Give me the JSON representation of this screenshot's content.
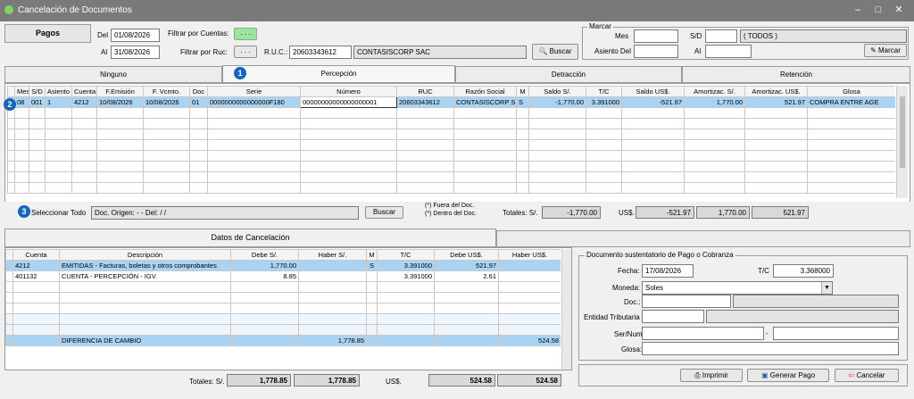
{
  "window": {
    "title": "Cancelación de Documentos"
  },
  "header": {
    "pagos_label": "Pagos",
    "del_label": "Del",
    "del_value": "01/08/2026",
    "al_label": "Al",
    "al_value": "31/08/2026",
    "filtrar_cuentas_label": "Filtrar por Cuentas:",
    "filtrar_cuentas_value": ". . .",
    "filtrar_ruc_label": "Filtrar por Ruc:",
    "filtrar_ruc_value": ". . .",
    "ruc_label": "R.U.C.:",
    "ruc_value": "20603343612",
    "razon_value": "CONTASISCORP SAC",
    "buscar_label": "Buscar"
  },
  "marcar": {
    "title": "Marcar",
    "mes_label": "Mes",
    "sd_label": "S/D",
    "todos_value": "( TODOS )",
    "asiento_label": "Asiento Del",
    "al_label": "Al",
    "button_label": "Marcar"
  },
  "tabs": [
    "Ninguno",
    "Percepción",
    "Detracción",
    "Retención"
  ],
  "badges": [
    "1",
    "2",
    "3"
  ],
  "doc_grid": {
    "columns": [
      "Mes",
      "S/D",
      "Asiento",
      "Cuenta",
      "F.Emisión",
      "F. Vcmto.",
      "Doc",
      "Serie",
      "Número",
      "RUC",
      "Razón Social",
      "M",
      "Saldo S/.",
      "T/C",
      "Saldo US$.",
      "Amortizac. S/.",
      "Amortizac. US$.",
      "Glosa"
    ],
    "rows": [
      [
        "08",
        "001",
        "1",
        "4212",
        "10/08/2026",
        "10/08/2026",
        "01",
        "0000000000000000F180",
        "00000000000000000001",
        "20603343612",
        "CONTASISCORP S",
        "S",
        "-1,770.00",
        "3.391000",
        "-521.97",
        "1,770.00",
        "521.97",
        "COMPRA ENTRE AGE"
      ]
    ]
  },
  "doc_footer": {
    "seleccionar_todo": "Seleccionar Todo",
    "origen": "Doc. Origen:  - -   Del:   / /",
    "buscar": "Buscar",
    "nota1": "(*) Fuera del Doc.",
    "nota2": "(*) Dentro del Doc.",
    "totales_label": "Totales: S/.",
    "tot_soles": "-1,770.00",
    "us_label": "US$.",
    "tot_us": "-521.97",
    "tot_amort_s": "1,770.00",
    "tot_amort_us": "521.97"
  },
  "cancel_tabs": [
    "Datos de Cancelación",
    ""
  ],
  "cancel_grid": {
    "columns": [
      "Cuenta",
      "Descripción",
      "Debe S/.",
      "Haber S/.",
      "M",
      "T/C",
      "Debe US$.",
      "Haber US$."
    ],
    "rows": [
      [
        "4212",
        "EMITIDAS - Facturas, boletas y otros comprobantes",
        "1,770.00",
        "",
        "S",
        "3.391000",
        "521.97",
        ""
      ],
      [
        "401132",
        "CUENTA - PERCEPCIÓN - IGV.",
        "8.85",
        "",
        "",
        "3.391000",
        "2.61",
        ""
      ]
    ],
    "diff_row": [
      "",
      "DIFERENCIA DE CAMBIO",
      "",
      "1,778.85",
      "",
      "",
      "",
      "524.58"
    ]
  },
  "cancel_totals": {
    "label": "Totales: S/.",
    "debe_s": "1,778.85",
    "haber_s": "1,778.85",
    "us_label": "US$.",
    "debe_us": "524.58",
    "haber_us": "524.58"
  },
  "sustento": {
    "title": "Documento sustentatorio de Pago o Cobranza",
    "fecha_label": "Fecha:",
    "fecha_value": "17/08/2026",
    "tc_label": "T/C",
    "tc_value": "3.368000",
    "moneda_label": "Moneda:",
    "moneda_value": "Soles",
    "doc_label": "Doc.:",
    "entidad_label": "Entidad Tributaria",
    "sernum_label": "Ser/Num",
    "sernum_sep": "-",
    "glosa_label": "Glosa:"
  },
  "actions": {
    "imprimir": "Imprimir",
    "generar": "Generar Pago",
    "cancelar": "Cancelar"
  },
  "colors": {
    "titlebar": "#7a7a7a",
    "selection": "#a9d3f3",
    "badge": "#1565c0",
    "green_button": "#9fe19f"
  }
}
